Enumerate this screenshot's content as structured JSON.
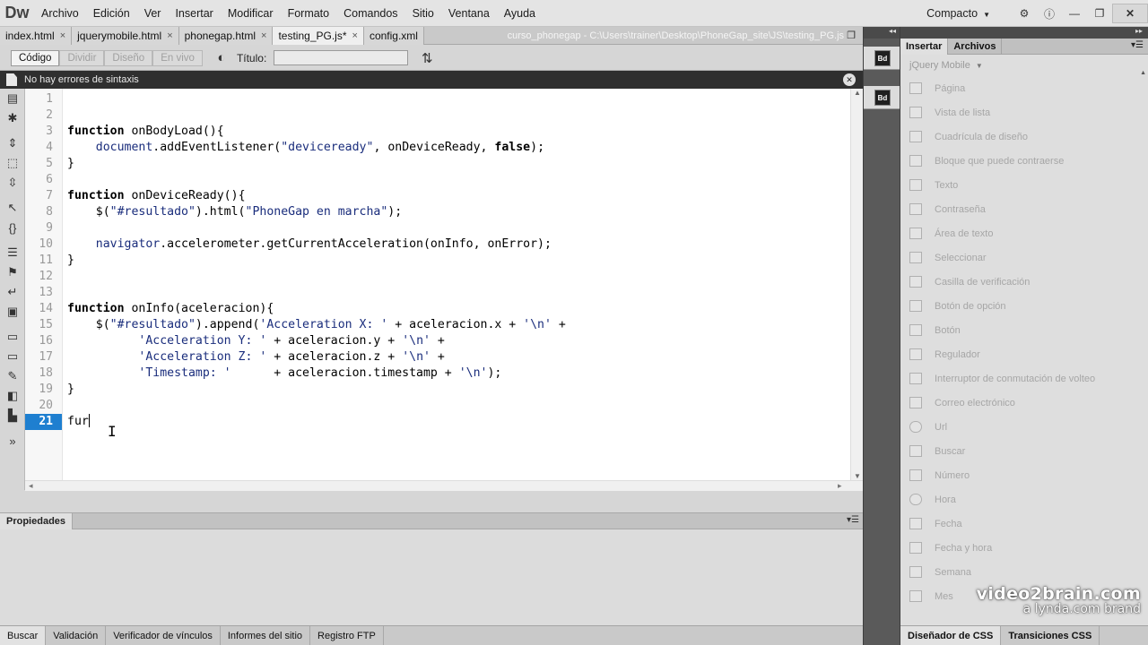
{
  "app": {
    "logo": "Dw",
    "workspace": "Compacto"
  },
  "menu": [
    "Archivo",
    "Edición",
    "Ver",
    "Insertar",
    "Modificar",
    "Formato",
    "Comandos",
    "Sitio",
    "Ventana",
    "Ayuda"
  ],
  "tabs": [
    {
      "label": "index.html",
      "active": false
    },
    {
      "label": "jquerymobile.html",
      "active": false
    },
    {
      "label": "phonegap.html",
      "active": false
    },
    {
      "label": "testing_PG.js*",
      "active": true
    },
    {
      "label": "config.xml",
      "active": false
    }
  ],
  "doc_path": "curso_phonegap - C:\\Users\\trainer\\Desktop\\PhoneGap_site\\JS\\testing_PG.js",
  "toolbar": {
    "views": [
      "Código",
      "Dividir",
      "Diseño",
      "En vivo"
    ],
    "active_view": "Código",
    "title_label": "Título:",
    "title_value": ""
  },
  "notification": "No hay errores de sintaxis",
  "editor": {
    "current_line": 21,
    "lines": [
      "",
      "",
      "function onBodyLoad(){",
      "    document.addEventListener(\"deviceready\", onDeviceReady, false);",
      "}",
      "",
      "function onDeviceReady(){",
      "    $(\"#resultado\").html(\"PhoneGap en marcha\");",
      "",
      "    navigator.accelerometer.getCurrentAcceleration(onInfo, onError);",
      "}",
      "",
      "",
      "function onInfo(aceleracion){",
      "    $(\"#resultado\").append('Acceleration X: ' + aceleracion.x + '\\n' +",
      "          'Acceleration Y: ' + aceleracion.y + '\\n' +",
      "          'Acceleration Z: ' + aceleracion.z + '\\n' +",
      "          'Timestamp: '      + aceleracion.timestamp + '\\n');",
      "}",
      "",
      "fur"
    ]
  },
  "properties": {
    "tab_label": "Propiedades"
  },
  "bottom_tabs": [
    "Buscar",
    "Validación",
    "Verificador de vínculos",
    "Informes del sitio",
    "Registro FTP"
  ],
  "right_panel": {
    "tabs": [
      "Insertar",
      "Archivos"
    ],
    "category": "jQuery Mobile",
    "items": [
      "Página",
      "Vista de lista",
      "Cuadrícula de diseño",
      "Bloque que puede contraerse",
      "Texto",
      "Contraseña",
      "Área de texto",
      "Seleccionar",
      "Casilla de verificación",
      "Botón de opción",
      "Botón",
      "Regulador",
      "Interruptor de conmutación de volteo",
      "Correo electrónico",
      "Url",
      "Buscar",
      "Número",
      "Hora",
      "Fecha",
      "Fecha y hora",
      "Semana",
      "Mes"
    ],
    "bottom_tabs": [
      "Diseñador de CSS",
      "Transiciones CSS"
    ]
  },
  "mid_strip_icons": [
    "Bd",
    "Bd"
  ],
  "watermark": {
    "line1": "video2brain.com",
    "line2": "a lynda.com brand"
  }
}
